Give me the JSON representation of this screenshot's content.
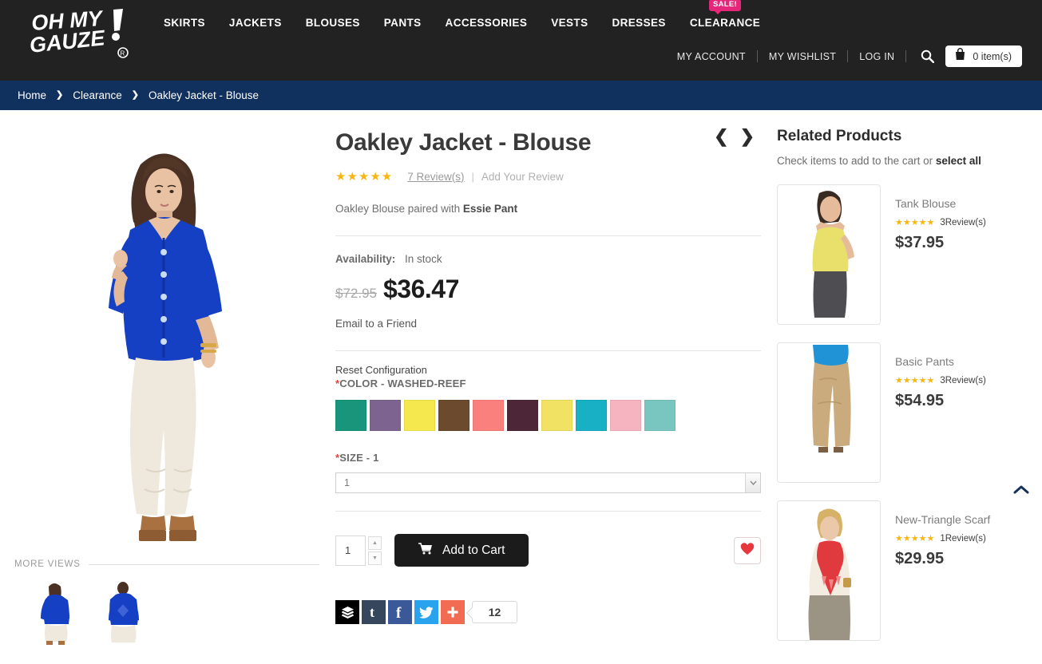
{
  "header": {
    "logo_line1": "OH MY",
    "logo_line2": "GAUZE",
    "logo_mark": "!",
    "nav": [
      {
        "label": "SKIRTS"
      },
      {
        "label": "JACKETS"
      },
      {
        "label": "BLOUSES"
      },
      {
        "label": "PANTS"
      },
      {
        "label": "ACCESSORIES"
      },
      {
        "label": "VESTS"
      },
      {
        "label": "DRESSES"
      },
      {
        "label": "CLEARANCE",
        "badge": "SALE!"
      }
    ],
    "account_links": [
      {
        "label": "MY ACCOUNT"
      },
      {
        "label": "MY WISHLIST"
      },
      {
        "label": "LOG IN"
      }
    ],
    "search_icon": "search-icon",
    "cart_icon": "shopping-bag-icon",
    "cart_label": "0 item(s)"
  },
  "breadcrumb": {
    "items": [
      {
        "label": "Home"
      },
      {
        "label": "Clearance"
      },
      {
        "label": "Oakley Jacket - Blouse"
      }
    ],
    "separator": "❯"
  },
  "gallery": {
    "more_views_label": "MORE VIEWS",
    "main_alt": "Model wearing royal blue Oakley button-front blouse with white pants",
    "thumbnails": [
      {
        "alt": "Front view"
      },
      {
        "alt": "Back view"
      }
    ]
  },
  "product": {
    "title": "Oakley Jacket - Blouse",
    "prev_icon": "chevron-left-icon",
    "next_icon": "chevron-right-icon",
    "stars": "★★★★★",
    "review_count": "7 Review(s)",
    "review_separator": "|",
    "add_review": "Add Your Review",
    "paired_prefix": "Oakley Blouse paired with ",
    "paired_link": "Essie Pant",
    "availability_label": "Availability:",
    "availability_value": "In stock",
    "old_price": "$72.95",
    "new_price": "$36.47",
    "email_friend": "Email to a Friend",
    "reset_configuration": "Reset Configuration",
    "color_required": "*",
    "color_label": "COLOR - WASHED-REEF",
    "colors": [
      {
        "name": "teal-green",
        "hex": "#18957a"
      },
      {
        "name": "muted-purple",
        "hex": "#7d6490"
      },
      {
        "name": "bright-yellow",
        "hex": "#f5e84f"
      },
      {
        "name": "brown",
        "hex": "#6b4a2d"
      },
      {
        "name": "coral",
        "hex": "#f9807d"
      },
      {
        "name": "dark-plum",
        "hex": "#4d2738"
      },
      {
        "name": "pale-yellow",
        "hex": "#f2e264"
      },
      {
        "name": "teal",
        "hex": "#17b0c4"
      },
      {
        "name": "pink",
        "hex": "#f5b4c0"
      },
      {
        "name": "washed-reef",
        "hex": "#79c6c0"
      }
    ],
    "size_required": "*",
    "size_label": "SIZE - 1",
    "size_value": "1",
    "size_options": [
      "1"
    ],
    "qty_value": "1",
    "qty_up_icon": "caret-up-icon",
    "qty_down_icon": "caret-down-icon",
    "add_to_cart": "Add to Cart",
    "cart_icon": "shopping-cart-icon",
    "wishlist_icon": "heart-icon"
  },
  "social": {
    "buttons": [
      {
        "name": "buffer",
        "glyph": "≡",
        "color": "#000000"
      },
      {
        "name": "tumblr",
        "glyph": "t",
        "color": "#36465d"
      },
      {
        "name": "facebook",
        "glyph": "f",
        "color": "#3b5998"
      },
      {
        "name": "twitter",
        "glyph": "✓",
        "color": "#2aa3ef"
      },
      {
        "name": "addthis",
        "glyph": "+",
        "color": "#f26c53"
      }
    ],
    "share_count": "12"
  },
  "related": {
    "title": "Related Products",
    "subtitle_prefix": "Check items to add to the cart or ",
    "select_all": "select all",
    "items": [
      {
        "name": "Tank Blouse",
        "stars": "★★★★★",
        "reviews": "3Review(s)",
        "price": "$37.95",
        "alt": "Model in yellow tank blouse with grey skirt"
      },
      {
        "name": "Basic Pants",
        "stars": "★★★★★",
        "reviews": "3Review(s)",
        "price": "$54.95",
        "alt": "Model in tan basic pants with blue top"
      },
      {
        "name": "New-Triangle Scarf",
        "stars": "★★★★★",
        "reviews": "1Review(s)",
        "price": "$29.95",
        "alt": "Model in red triangle scarf with cream top"
      }
    ]
  },
  "scroll_top_icon": "chevron-up-icon",
  "colors": {
    "header_bg": "#222222",
    "breadcrumb_bg": "#10305e",
    "sale_badge": "#e6267a",
    "star_gold": "#f6b712",
    "accent_dark": "#1b1b1b"
  }
}
